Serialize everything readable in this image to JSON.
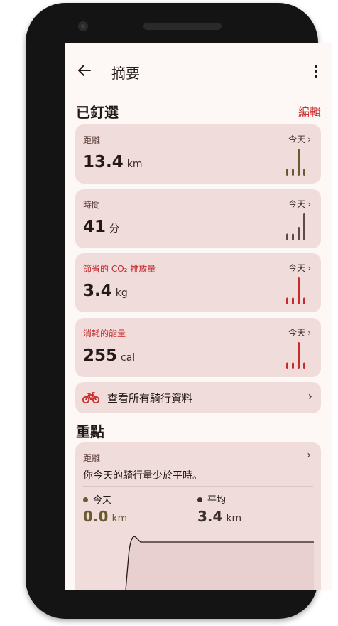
{
  "appbar": {
    "title": "摘要"
  },
  "pinned": {
    "title": "已釘選",
    "edit_label": "編輯",
    "cards": [
      {
        "label": "距離",
        "value": "13.4",
        "unit": "km",
        "period": "今天",
        "color": "#6b5a30",
        "chart_data": {
          "type": "bar",
          "values": [
            1,
            1,
            4,
            1
          ]
        }
      },
      {
        "label": "時間",
        "value": "41",
        "unit": "分",
        "period": "今天",
        "color": "#5a4a48",
        "chart_data": {
          "type": "bar",
          "values": [
            1,
            1,
            2,
            4
          ]
        }
      },
      {
        "label": "節省的 CO₂ 排放量",
        "value": "3.4",
        "unit": "kg",
        "period": "今天",
        "color": "#c62a2a",
        "chart_data": {
          "type": "bar",
          "values": [
            1,
            1,
            4,
            1
          ]
        }
      },
      {
        "label": "消耗的能量",
        "value": "255",
        "unit": "cal",
        "period": "今天",
        "color": "#c62a2a",
        "chart_data": {
          "type": "bar",
          "values": [
            1,
            1,
            4,
            1
          ]
        }
      }
    ]
  },
  "all_rides": {
    "label": "查看所有騎行資料",
    "icon": "bike-icon"
  },
  "highlights": {
    "title": "重點",
    "card": {
      "label": "距離",
      "text": "你今天的騎行量少於平時。",
      "today": {
        "label": "今天",
        "value": "0.0",
        "unit": "km",
        "color": "#6b5a30"
      },
      "average": {
        "label": "平均",
        "value": "3.4",
        "unit": "km",
        "color": "#3a2f2d"
      }
    }
  }
}
